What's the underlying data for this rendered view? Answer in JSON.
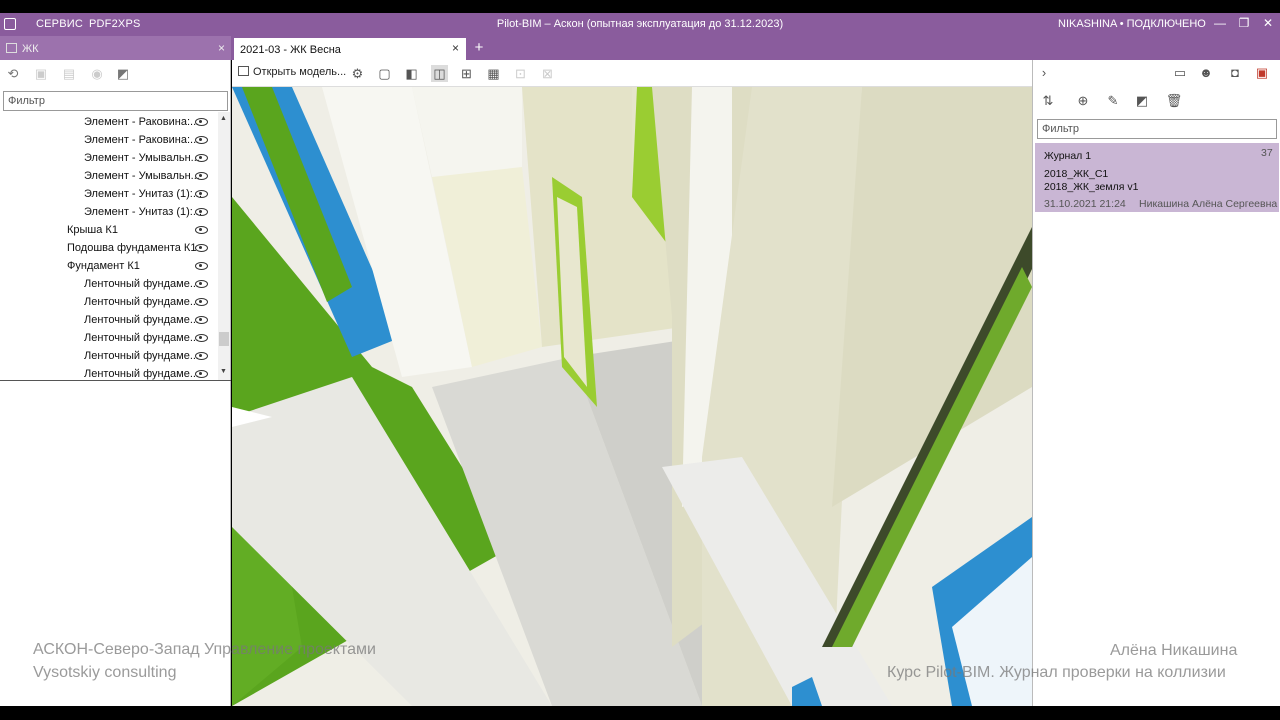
{
  "titlebar": {
    "menu": [
      "СЕРВИС",
      "PDF2XPS"
    ],
    "title": "Pilot-BIM – Аскон (опытная эксплуатация до 31.12.2023)",
    "user": "NIKASHINA • ПОДКЛЮЧЕНО",
    "min": "—",
    "max": "❐",
    "close": "✕"
  },
  "tabs": {
    "left_tab": "ЖК",
    "active_tab": "2021-03 - ЖК Весна",
    "close": "×",
    "add": "+"
  },
  "left_panel": {
    "filter_placeholder": "Фильтр",
    "tree": [
      {
        "label": "Элемент - Раковина:...",
        "indent": 2
      },
      {
        "label": "Элемент - Раковина:...",
        "indent": 2
      },
      {
        "label": "Элемент - Умывальн...",
        "indent": 2
      },
      {
        "label": "Элемент - Умывальн...",
        "indent": 2
      },
      {
        "label": "Элемент - Унитаз (1):...",
        "indent": 2
      },
      {
        "label": "Элемент - Унитаз (1):...",
        "indent": 2
      },
      {
        "label": "Крыша К1",
        "indent": 1
      },
      {
        "label": "Подошва фундамента К1",
        "indent": 1
      },
      {
        "label": "Фундамент К1",
        "indent": 1
      },
      {
        "label": "Ленточный фундаме...",
        "indent": 2
      },
      {
        "label": "Ленточный фундаме...",
        "indent": 2
      },
      {
        "label": "Ленточный фундаме...",
        "indent": 2
      },
      {
        "label": "Ленточный фундаме...",
        "indent": 2
      },
      {
        "label": "Ленточный фундаме...",
        "indent": 2
      },
      {
        "label": "Ленточный фундаме...",
        "indent": 2
      }
    ]
  },
  "view_toolbar": {
    "open_model": "Открыть модель..."
  },
  "right_panel": {
    "filter_placeholder": "Фильтр",
    "journal": {
      "title": "Журнал 1",
      "count": "37",
      "line1": "2018_ЖК_С1",
      "line2": "2018_ЖК_земля v1",
      "date": "31.10.2021 21:24",
      "author": "Никашина Алёна Сергеевна"
    }
  },
  "watermarks": {
    "left_line1": "АСКОН-Северо-Запад Управление проектами",
    "left_line2": "Vysotskiy consulting",
    "right_line1": "Алёна Никашина",
    "right_line2": "Курс Pilot-BIM. Журнал проверки на коллизии"
  },
  "colors": {
    "titlebar": "#8a5c9d",
    "journal_selected": "#c9b6d4",
    "model_green": "#5aa51e",
    "model_blue": "#2d8fd0"
  }
}
